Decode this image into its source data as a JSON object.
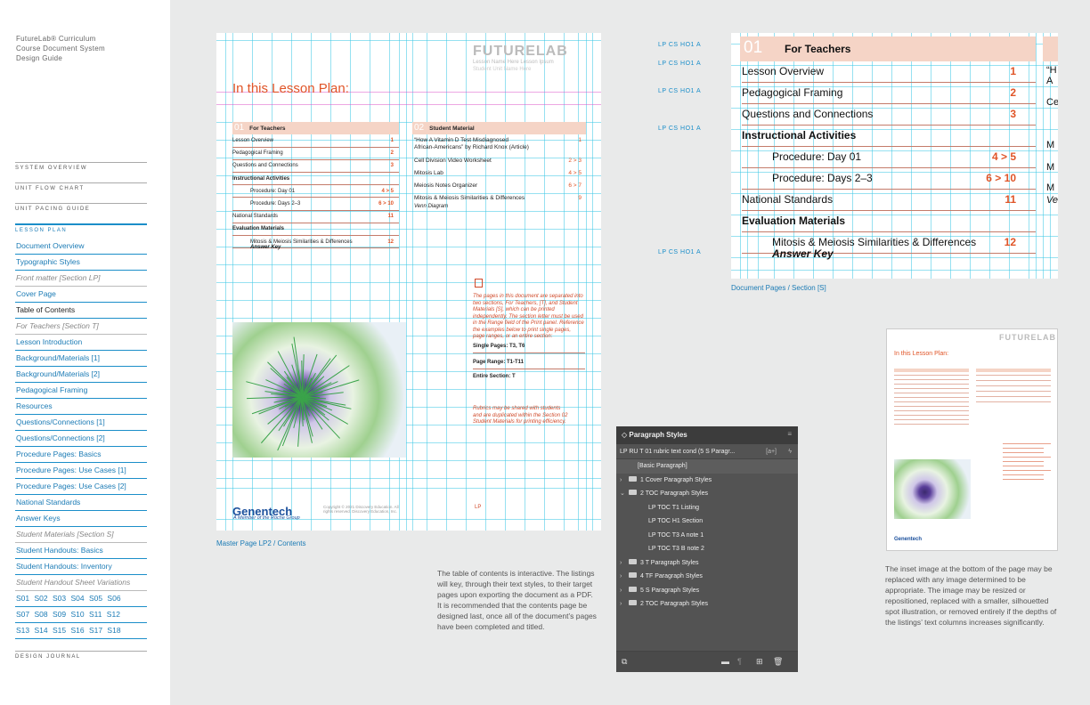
{
  "sidebar": {
    "title": "FutureLab® Curriculum\nCourse Document System\nDesign Guide",
    "sections": [
      "SYSTEM OVERVIEW",
      "UNIT FLOW CHART",
      "UNIT PACING GUIDE",
      "LESSON PLAN",
      "DESIGN JOURNAL"
    ],
    "toc": [
      "Document Overview",
      "Typographic Styles",
      "Front matter [Section LP]",
      "Cover Page",
      "Table of Contents",
      "For Teachers [Section T]",
      "Lesson Introduction",
      "Background/Materials [1]",
      "Background/Materials [2]",
      "Pedagogical Framing",
      "Resources",
      "Questions/Connections [1]",
      "Questions/Connections [2]",
      "Procedure Pages: Basics",
      "Procedure Pages: Use Cases [1]",
      "Procedure Pages: Use Cases [2]",
      "National Standards",
      "Answer Keys",
      "Student Materials [Section S]",
      "Student Handouts: Basics",
      "Student Handouts: Inventory",
      "Student Handout Sheet Variations",
      "S01  S02  S03  S04  S05  S06",
      "S07  S08  S09  S10  S11  S12",
      "S13  S14  S15  S16  S17  S18"
    ]
  },
  "master": {
    "logo": "FUTURELAB",
    "lesson_name": "Lesson Name Here Lesson Ipsum",
    "unit_name": "Student Unit Name Here",
    "heading": "In this Lesson Plan:",
    "col1_num": "01",
    "col1_title": "For Teachers",
    "col1_rows": [
      {
        "label": "Lesson Overview",
        "page": "1"
      },
      {
        "label": "Pedagogical Framing",
        "page": "2"
      },
      {
        "label": "Questions and Connections",
        "page": "3"
      },
      {
        "label": "Instructional Activities",
        "page": ""
      },
      {
        "label": "Procedure: Day 01",
        "page": "4 > 5"
      },
      {
        "label": "Procedure: Days 2–3",
        "page": "6 > 10"
      },
      {
        "label": "National Standards",
        "page": "11"
      },
      {
        "label": "Evaluation Materials",
        "page": ""
      },
      {
        "label": "Mitosis & Meiosis Similarities & Differences",
        "page": "12"
      }
    ],
    "answer_key": "Answer Key",
    "col2_num": "02",
    "col2_title": "Student Material",
    "col2_rows": [
      {
        "label": "“How A Vitamin D Test Misdiagnosed",
        "page": "1"
      },
      {
        "label": "African-Americans” by Richard Knox (Article)",
        "page": ""
      },
      {
        "label": "Cell Division Video Worksheet",
        "page": "2 > 3"
      },
      {
        "label": "Mitosis Lab",
        "page": "4 > 5"
      },
      {
        "label": "Meiosis Notes Organizer",
        "page": "6 > 7"
      },
      {
        "label": "Mitosis & Meiosis Similarities & Differences",
        "page": "9"
      }
    ],
    "venn": "Venn Diagram",
    "note1": "The pages in this document are separated into two sections, For Teachers, [T], and Student Materials [S], which can be printed independently. The section letter must be used in the Range field of the Print panel. Reference the examples below to print single pages, page ranges, or an entire section:",
    "single": "Single Pages: T3, T6",
    "range": "Page Range: T1-T11",
    "entire": "Entire Section: T",
    "note2": "Rubrics may be shared with students and are duplicated within the Section 02 Student Materials for printing efficiency.",
    "genentech": "Genentech",
    "roche": "A Member of the Roche Group",
    "copyright": "Copyright © 2021 Discovery Education. All rights reserved. Discovery Education, Inc.",
    "caption": "Master Page LP2 / Contents"
  },
  "zoom": {
    "num": "01",
    "title": "For Teachers",
    "rows": [
      {
        "label": "Lesson Overview",
        "page": "1"
      },
      {
        "label": "Pedagogical Framing",
        "page": "2"
      },
      {
        "label": "Questions and Connections",
        "page": "3"
      },
      {
        "label": "Instructional Activities",
        "page": ""
      },
      {
        "label": "Procedure: Day 01",
        "page": "4 > 5"
      },
      {
        "label": "Procedure: Days 2–3",
        "page": "6 > 10"
      },
      {
        "label": "National Standards",
        "page": "11"
      },
      {
        "label": "Evaluation Materials",
        "page": ""
      },
      {
        "label": "Mitosis & Meiosis Similarities & Differences",
        "page": "12"
      }
    ],
    "answer_key": "Answer Key",
    "style_tags": [
      "LP CS HO1 A",
      "LP CS HO1 A",
      "LP CS HO1 A",
      "LP CS HO1 A",
      "LP CS HO1 A"
    ],
    "side_fragments": [
      "“H",
      "A",
      "Ce",
      "M",
      "M",
      "M",
      "Ve"
    ],
    "caption": "Document Pages / Section [S]"
  },
  "panel": {
    "title": "Paragraph Styles",
    "current": "LP RU T 01  rubric text cond (5  S Paragr...",
    "items": [
      {
        "label": "[Basic Paragraph]",
        "kind": "style",
        "indent": 1
      },
      {
        "label": "1  Cover Paragraph Styles",
        "kind": "folder",
        "indent": 0,
        "open": false
      },
      {
        "label": "2  TOC Paragraph Styles",
        "kind": "folder",
        "indent": 0,
        "open": true
      },
      {
        "label": "LP  TOC T1 Listing",
        "kind": "style",
        "indent": 2
      },
      {
        "label": "LP  TOC H1 Section",
        "kind": "style",
        "indent": 2
      },
      {
        "label": "LP  TOC T3 A  note 1",
        "kind": "style",
        "indent": 2
      },
      {
        "label": "LP  TOC T3 B  note 2",
        "kind": "style",
        "indent": 2
      },
      {
        "label": "3  T Paragraph Styles",
        "kind": "folder",
        "indent": 0,
        "open": false
      },
      {
        "label": "4  TF Paragraph Styles",
        "kind": "folder",
        "indent": 0,
        "open": false
      },
      {
        "label": "5  S Paragraph Styles",
        "kind": "folder",
        "indent": 0,
        "open": false
      },
      {
        "label": "2 TOC Paragraph Styles",
        "kind": "folder",
        "indent": 0,
        "open": false
      }
    ]
  },
  "thumb": {
    "logo": "FUTURELAB",
    "heading": "In this Lesson Plan:",
    "genentech": "Genentech"
  },
  "desc1": "The table of contents is interactive. The listings will key, through their text styles, to their target pages upon exporting the document as a PDF. It is recommended that the contents page be designed last, once all of the document’s pages have been completed and titled.",
  "desc2": "The inset image at the bottom of the page may be replaced with any image determined to be appropriate. The image may be resized or repositioned, replaced with a smaller, silhouetted spot illustration, or removed entirely if the depths of the listings’ text columns increases significantly."
}
